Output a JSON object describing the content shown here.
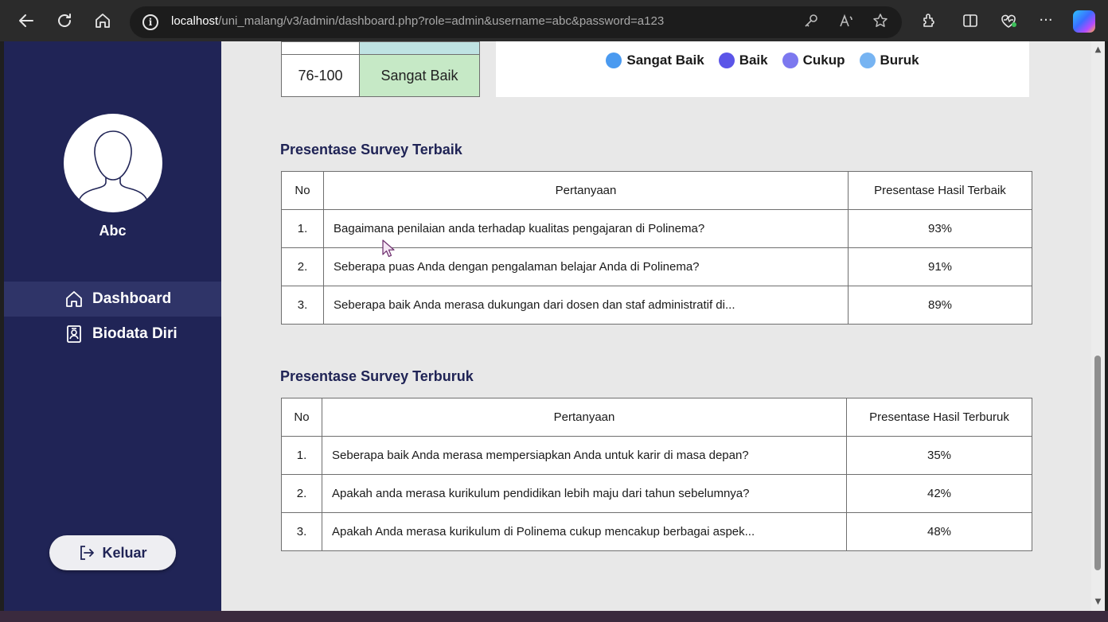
{
  "browser": {
    "url_host": "localhost",
    "url_path": "/uni_malang/v3/admin/dashboard.php?role=admin&username=abc&password=a123"
  },
  "sidebar": {
    "username": "Abc",
    "items": [
      {
        "label": "Dashboard",
        "icon": "home-icon",
        "active": true
      },
      {
        "label": "Biodata Diri",
        "icon": "id-badge-icon",
        "active": false
      }
    ],
    "logout_label": "Keluar"
  },
  "score_range": {
    "range": "76-100",
    "label": "Sangat Baik",
    "label_bg": "#c6e9c6",
    "upper_bg": "#bfe3e3"
  },
  "legend": [
    {
      "label": "Sangat Baik",
      "color": "#4a9af0"
    },
    {
      "label": "Baik",
      "color": "#5b55e8"
    },
    {
      "label": "Cukup",
      "color": "#7c78ef"
    },
    {
      "label": "Buruk",
      "color": "#77b4f2"
    }
  ],
  "best_survey": {
    "title": "Presentase Survey Terbaik",
    "headers": [
      "No",
      "Pertanyaan",
      "Presentase Hasil Terbaik"
    ],
    "rows": [
      {
        "no": "1.",
        "question": "Bagaimana penilaian anda terhadap kualitas pengajaran di Polinema?",
        "percent": "93%"
      },
      {
        "no": "2.",
        "question": "Seberapa puas Anda dengan pengalaman belajar Anda di Polinema?",
        "percent": "91%"
      },
      {
        "no": "3.",
        "question": "Seberapa baik Anda merasa dukungan dari dosen dan staf administratif di...",
        "percent": "89%"
      }
    ]
  },
  "worst_survey": {
    "title": "Presentase Survey Terburuk",
    "headers": [
      "No",
      "Pertanyaan",
      "Presentase Hasil Terburuk"
    ],
    "rows": [
      {
        "no": "1.",
        "question": "Seberapa baik Anda merasa mempersiapkan Anda untuk karir di masa depan?",
        "percent": "35%"
      },
      {
        "no": "2.",
        "question": "Apakah anda merasa kurikulum pendidikan lebih maju dari tahun sebelumnya?",
        "percent": "42%"
      },
      {
        "no": "3.",
        "question": "Apakah Anda merasa kurikulum di Polinema cukup mencakup berbagai aspek...",
        "percent": "48%"
      }
    ]
  },
  "colors": {
    "sidebar_bg": "#202456",
    "accent": "#202456",
    "page_bg": "#e8e8e8"
  }
}
